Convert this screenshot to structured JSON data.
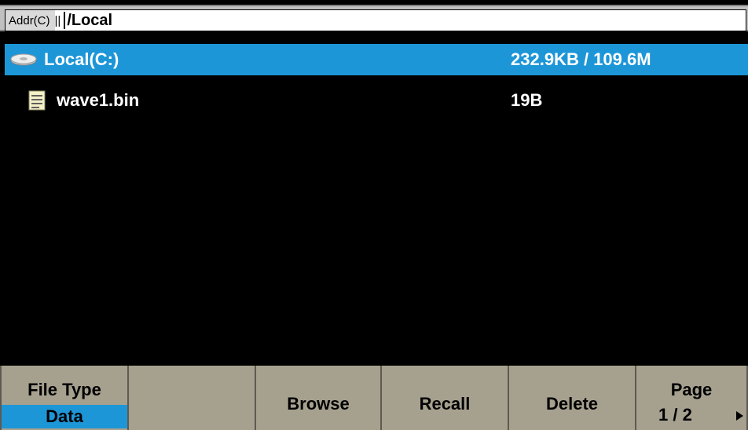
{
  "address_bar": {
    "label": "Addr(C)",
    "separator": "||",
    "path": "/Local"
  },
  "files": [
    {
      "name": "Local(C:)",
      "size": "232.9KB / 109.6M",
      "icon": "drive-icon",
      "selected": true
    },
    {
      "name": "wave1.bin",
      "size": "19B",
      "icon": "file-icon",
      "selected": false
    }
  ],
  "softkeys": {
    "file_type": {
      "title": "File Type",
      "value": "Data"
    },
    "browse": "Browse",
    "recall": "Recall",
    "delete": "Delete",
    "page": {
      "title": "Page",
      "value": "1 / 2"
    }
  },
  "colors": {
    "selection": "#1d96d8",
    "softkey_bg": "#a6a18f",
    "background": "#000000"
  }
}
